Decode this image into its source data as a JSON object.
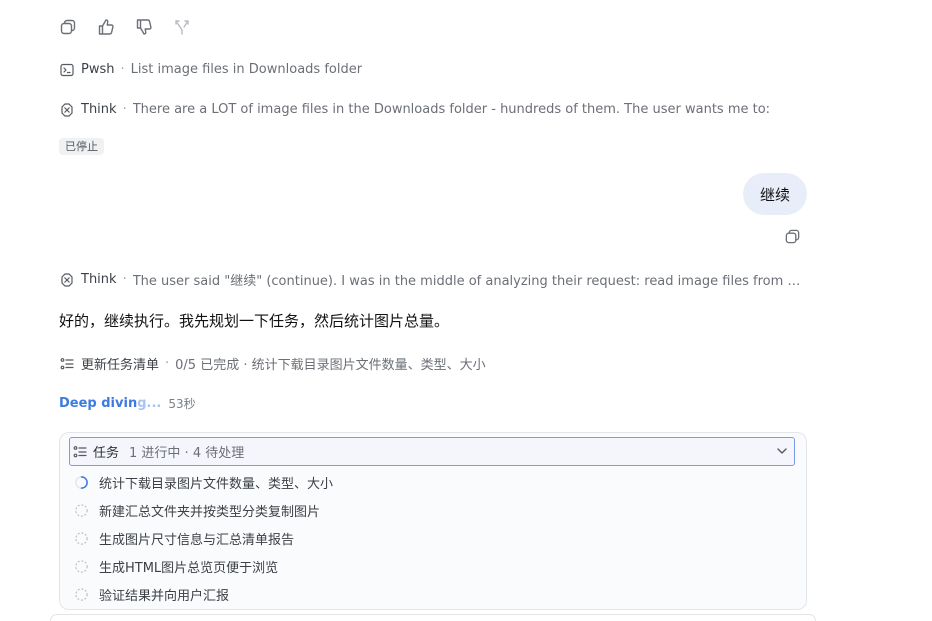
{
  "actions": {
    "copy": "copy-icon",
    "like": "thumbs-up-icon",
    "dislike": "thumbs-down-icon",
    "branch": "branch-icon"
  },
  "steps": [
    {
      "icon": "terminal-icon",
      "label": "Pwsh",
      "detail": "List image files in Downloads folder"
    },
    {
      "icon": "brain-icon",
      "label": "Think",
      "detail": "There are a LOT of image files in the Downloads folder - hundreds of them. The user wants me to:"
    }
  ],
  "stopped_badge": "已停止",
  "user_message": "继续",
  "think2": {
    "label": "Think",
    "detail": "The user said \"继续\" (continue). I was in the middle of analyzing their request: read image files from the Do..."
  },
  "answer": "好的，继续执行。我先规划一下任务，然后统计图片总量。",
  "todo_update": {
    "label": "更新任务清单",
    "detail": "0/5 已完成 · 统计下载目录图片文件数量、类型、大小"
  },
  "deep_diving": {
    "text_a": "Deep divin",
    "text_b": "g...",
    "time": "53秒"
  },
  "tasks": {
    "title": "任务",
    "summary": "1 进行中 · 4 待处理",
    "items": [
      {
        "label": "统计下载目录图片文件数量、类型、大小",
        "status": "in_progress"
      },
      {
        "label": "新建汇总文件夹并按类型分类复制图片",
        "status": "pending"
      },
      {
        "label": "生成图片尺寸信息与汇总清单报告",
        "status": "pending"
      },
      {
        "label": "生成HTML图片总览页便于浏览",
        "status": "pending"
      },
      {
        "label": "验证结果并向用户汇报",
        "status": "pending"
      }
    ]
  },
  "colors": {
    "accent": "#3d7be0",
    "bubble": "#e8eef9",
    "header_border": "#7a9ce8"
  }
}
